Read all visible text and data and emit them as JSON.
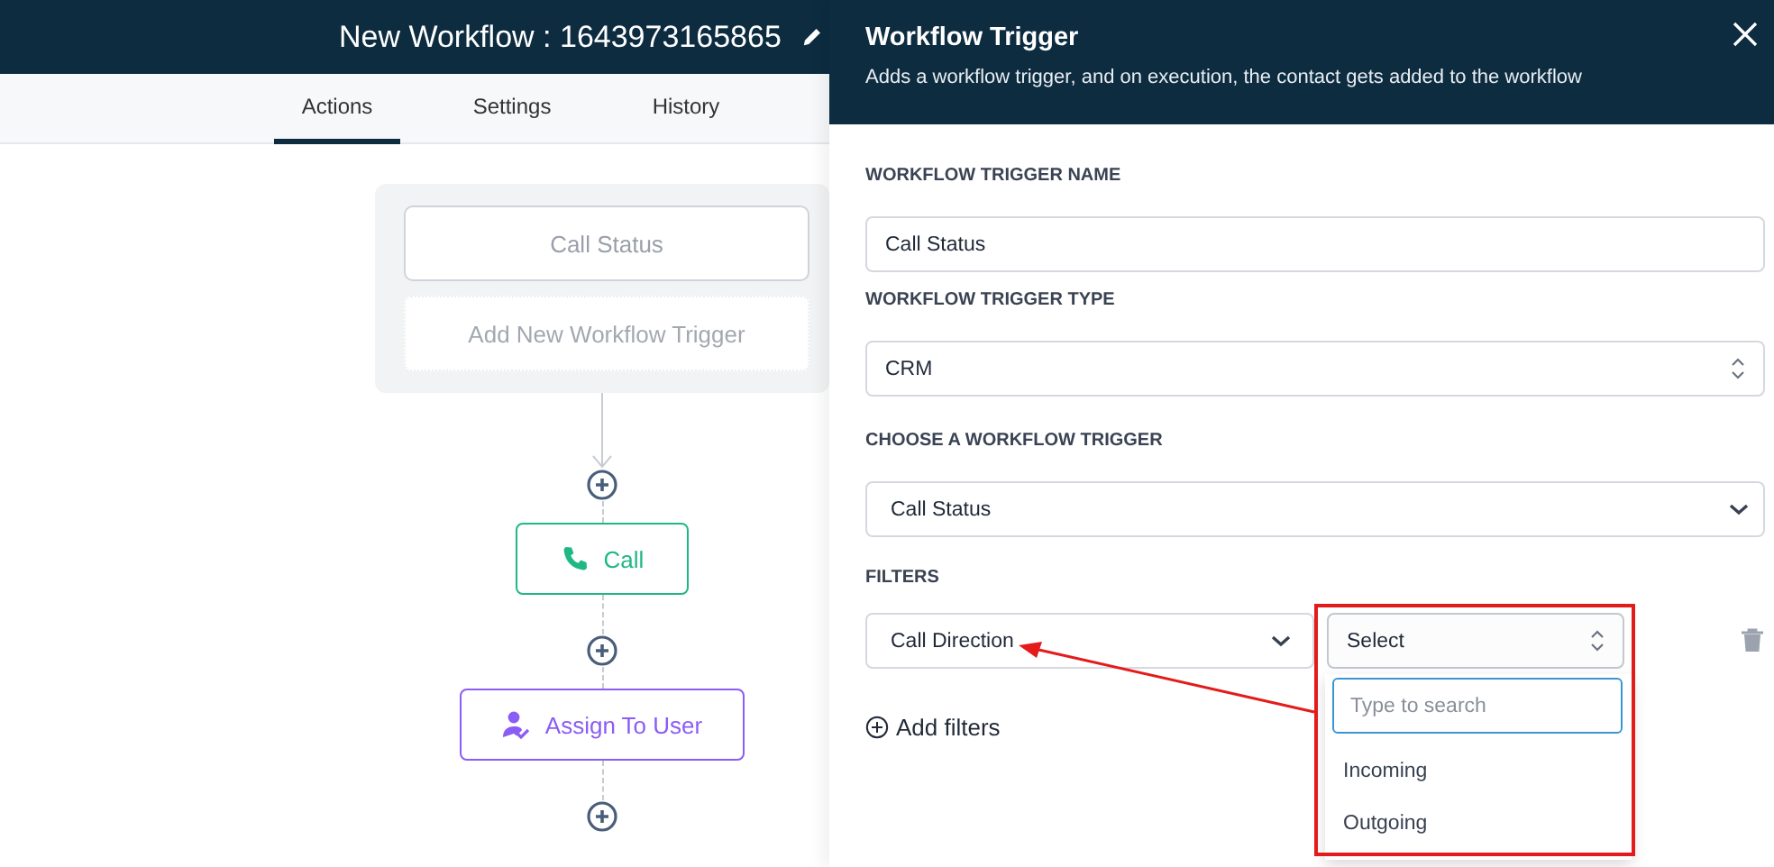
{
  "workflow_title": "New Workflow : 1643973165865",
  "tabs": [
    {
      "label": "Actions",
      "selected": true
    },
    {
      "label": "Settings",
      "selected": false
    },
    {
      "label": "History",
      "selected": false
    }
  ],
  "trigger_card": {
    "triggers": [
      "Call Status"
    ],
    "add_label": "Add New Workflow Trigger"
  },
  "steps": [
    {
      "kind": "call",
      "label": "Call",
      "color": "#1fb884"
    },
    {
      "kind": "assign",
      "label": "Assign To User",
      "color": "#8b5cf6"
    }
  ],
  "panel": {
    "title": "Workflow Trigger",
    "subtitle": "Adds a workflow trigger, and on execution, the contact gets added to the workflow",
    "fields": [
      {
        "kind": "text",
        "label": "WORKFLOW TRIGGER NAME",
        "value": "Call Status"
      },
      {
        "kind": "stepper",
        "label": "WORKFLOW TRIGGER TYPE",
        "value": "CRM"
      },
      {
        "kind": "dropdown",
        "label": "CHOOSE A WORKFLOW TRIGGER",
        "value": "Call Status"
      }
    ],
    "filters": {
      "label": "FILTERS",
      "rows": [
        {
          "field": "Call Direction",
          "value": "Select",
          "expanded": true,
          "search_placeholder": "Type to search",
          "options": [
            "Incoming",
            "Outgoing"
          ]
        }
      ],
      "add_label": "Add filters"
    }
  }
}
